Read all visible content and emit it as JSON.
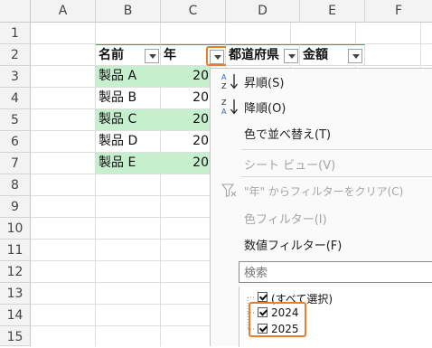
{
  "columns": [
    "A",
    "B",
    "C",
    "D",
    "E",
    "F"
  ],
  "rows": [
    "1",
    "2",
    "3",
    "4",
    "5",
    "6",
    "7",
    "8",
    "9",
    "10",
    "11",
    "12",
    "13",
    "14",
    "15"
  ],
  "headers": {
    "name": "名前",
    "year": "年",
    "pref": "都道府県",
    "amount": "金額"
  },
  "products": [
    "製品 A",
    "製品 B",
    "製品 C",
    "製品 D",
    "製品 E"
  ],
  "year_fragments": [
    "20",
    "20",
    "20",
    "20",
    "20"
  ],
  "colors": {
    "accent": "#e87d2a",
    "green_row": "#c6efce"
  },
  "menu": {
    "sort_asc": "昇順(S)",
    "sort_desc": "降順(O)",
    "sort_color": "色で並べ替え(T)",
    "sheet_view": "シート ビュー(V)",
    "clear_filter": "\"年\" からフィルターをクリア(C)",
    "color_filter": "色フィルター(I)",
    "number_filter": "数値フィルター(F)",
    "search_placeholder": "検索",
    "check_items": [
      {
        "label": "(すべて選択)",
        "checked": true
      },
      {
        "label": "2024",
        "checked": true
      },
      {
        "label": "2025",
        "checked": true
      }
    ]
  },
  "icons": {
    "sort_asc": "sort-ascending-icon",
    "sort_desc": "sort-descending-icon",
    "clear": "filter-clear-icon"
  }
}
